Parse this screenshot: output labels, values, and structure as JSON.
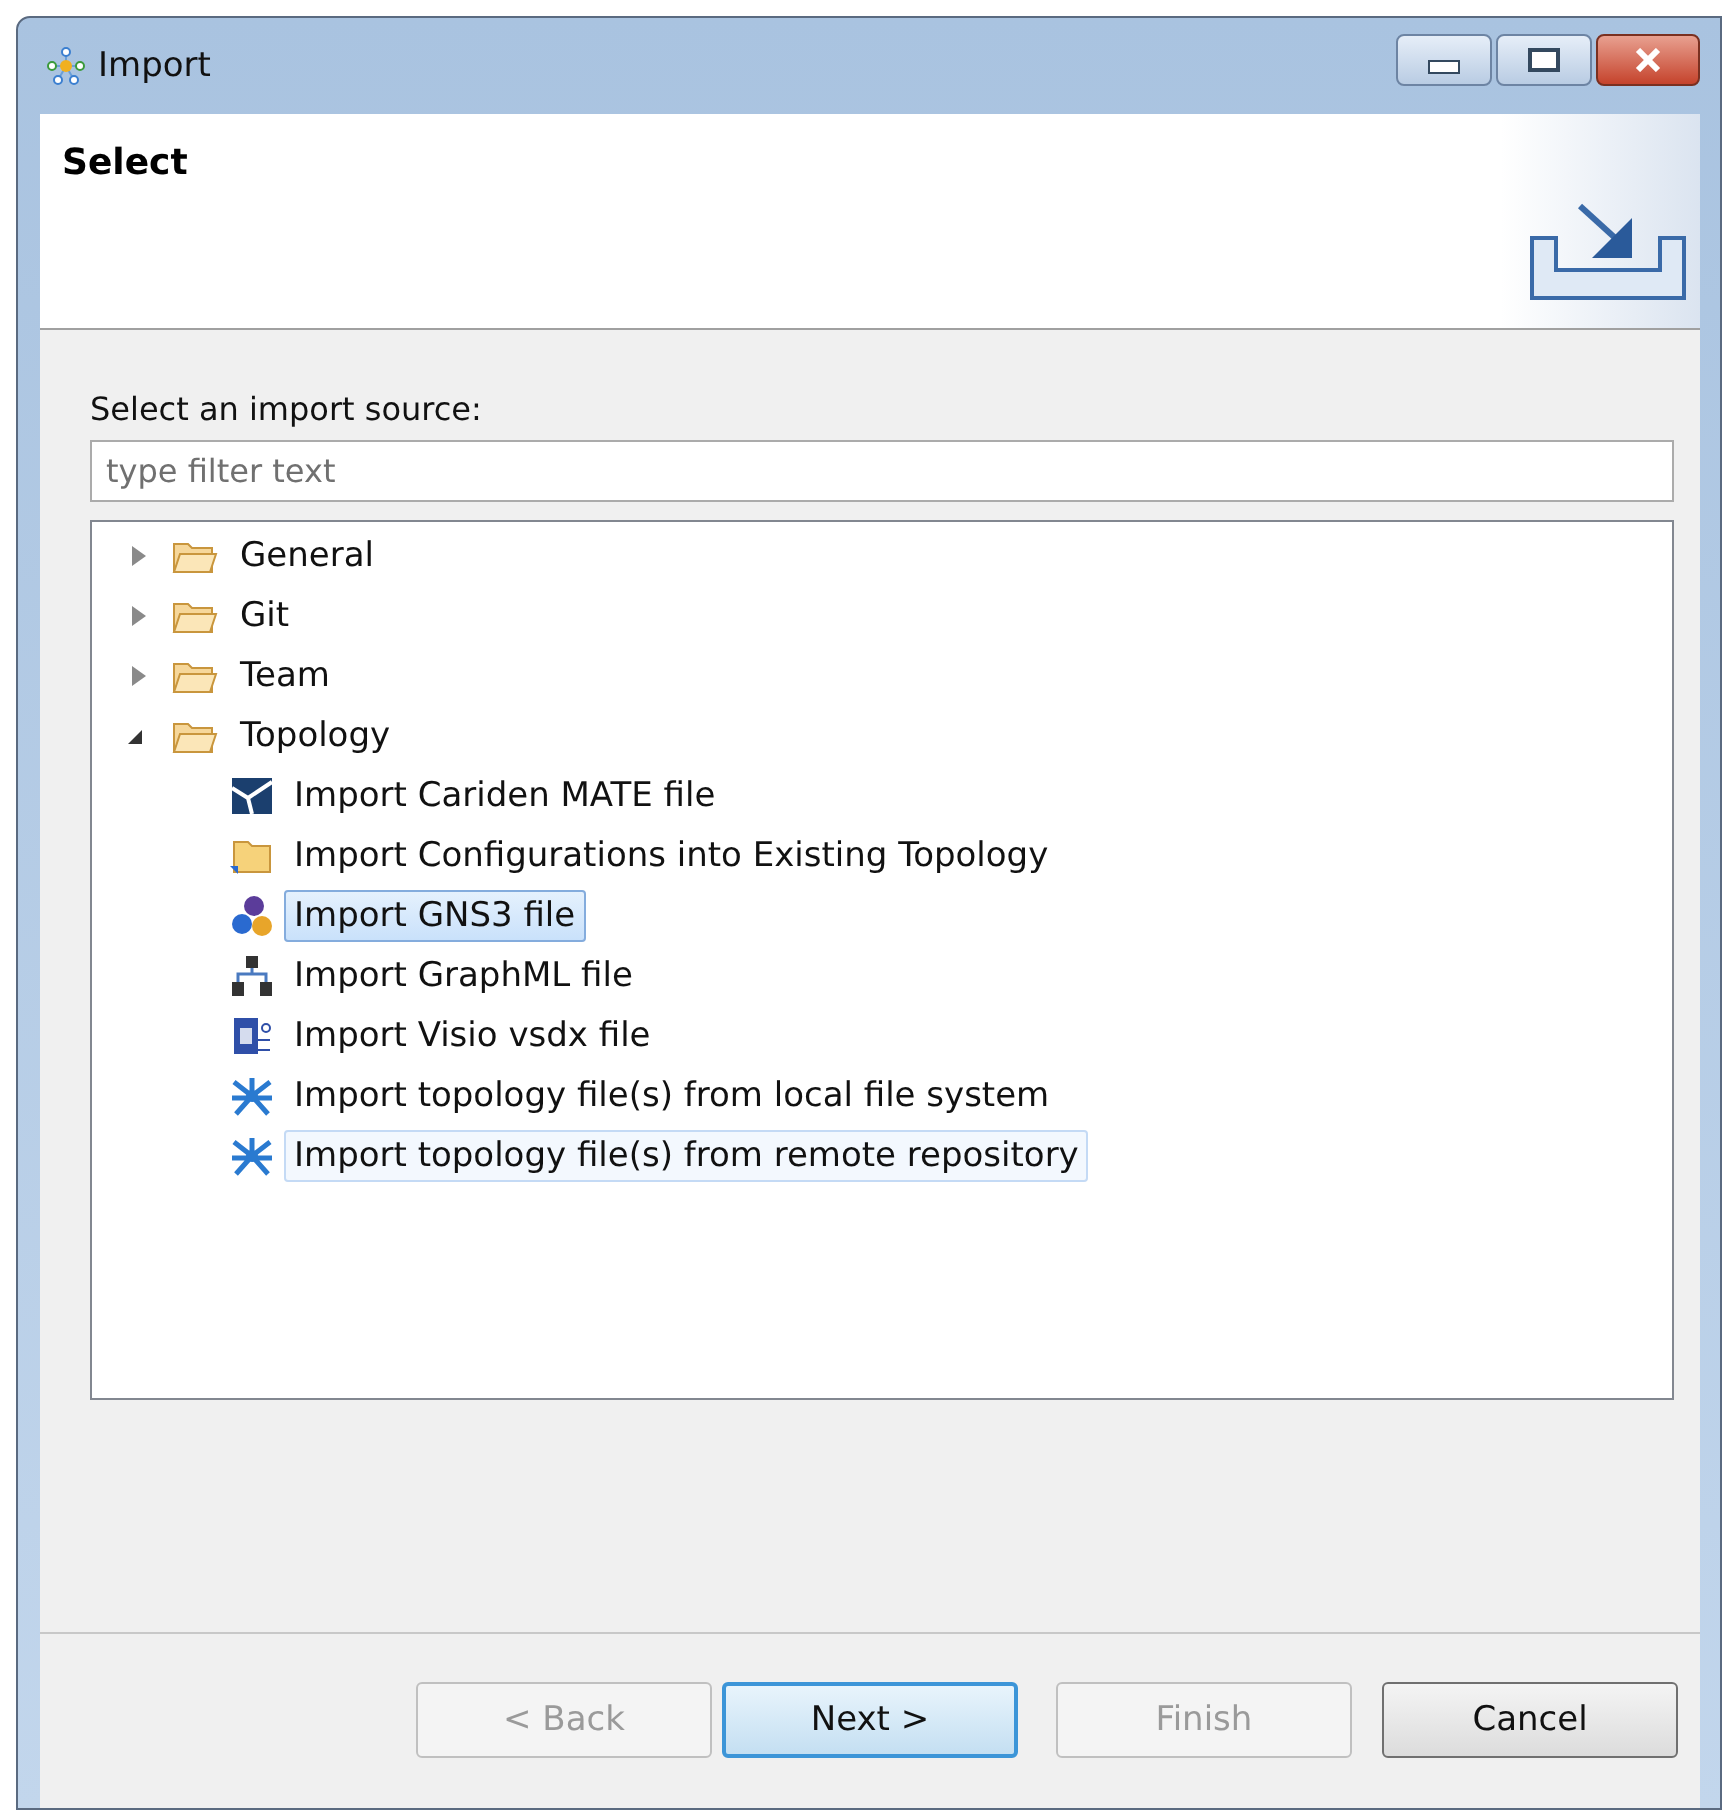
{
  "window": {
    "title": "Import"
  },
  "header": {
    "title": "Select"
  },
  "source_label": "Select an import source:",
  "filter": {
    "placeholder": "type filter text"
  },
  "tree": [
    {
      "label": "General",
      "expanded": false
    },
    {
      "label": "Git",
      "expanded": false
    },
    {
      "label": "Team",
      "expanded": false
    },
    {
      "label": "Topology",
      "expanded": true,
      "children": [
        {
          "label": "Import Cariden MATE file",
          "kind": "mate",
          "selected": false,
          "hovered": false
        },
        {
          "label": "Import Configurations into Existing Topology",
          "kind": "folder",
          "selected": false,
          "hovered": false
        },
        {
          "label": "Import GNS3 file",
          "kind": "gns3",
          "selected": true,
          "hovered": false
        },
        {
          "label": "Import GraphML file",
          "kind": "graphml",
          "selected": false,
          "hovered": false
        },
        {
          "label": "Import Visio vsdx file",
          "kind": "visio",
          "selected": false,
          "hovered": false
        },
        {
          "label": "Import topology file(s) from local file system",
          "kind": "topology",
          "selected": false,
          "hovered": false
        },
        {
          "label": "Import topology file(s) from remote repository",
          "kind": "topology",
          "selected": false,
          "hovered": true
        }
      ]
    }
  ],
  "buttons": [
    {
      "label": "< Back",
      "disabled": true,
      "default": false
    },
    {
      "label": "Next >",
      "disabled": false,
      "default": true
    },
    {
      "label": "Finish",
      "disabled": true,
      "default": false
    },
    {
      "label": "Cancel",
      "disabled": false,
      "default": false
    }
  ]
}
